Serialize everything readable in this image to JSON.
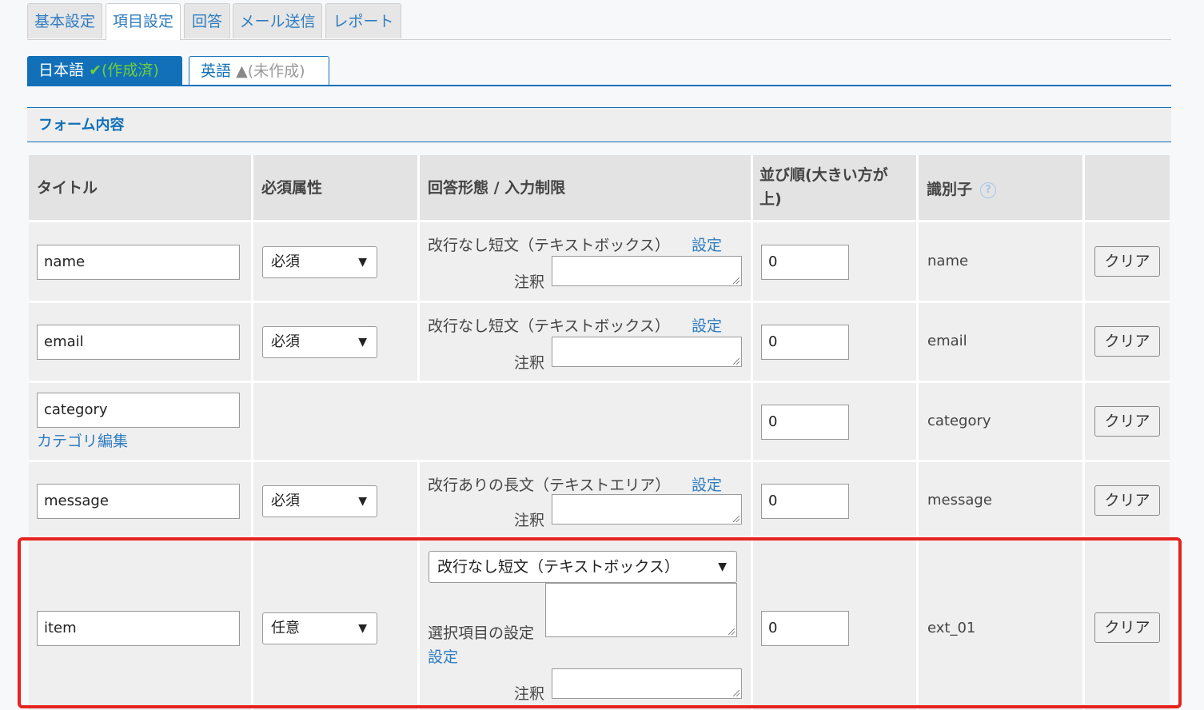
{
  "tabs": [
    {
      "label": "基本設定"
    },
    {
      "label": "項目設定"
    },
    {
      "label": "回答"
    },
    {
      "label": "メール送信"
    },
    {
      "label": "レポート"
    }
  ],
  "languages": {
    "ja": {
      "label": "日本語",
      "status": "(作成済)"
    },
    "en": {
      "label": "英語",
      "status": "(未作成)"
    }
  },
  "section_title": "フォーム内容",
  "columns": {
    "title": "タイトル",
    "required": "必須属性",
    "answer_type": "回答形態 / 入力制限",
    "order": "並び順(大きい方が上)",
    "identifier": "識別子",
    "help": "?"
  },
  "labels": {
    "setting_link": "設定",
    "note": "注釈",
    "clear": "クリア",
    "category_edit": "カテゴリ編集",
    "choice_setting": "選択項目の設定"
  },
  "rows": [
    {
      "title": "name",
      "required": "必須",
      "answer_type": "改行なし短文（テキストボックス）",
      "order": "0",
      "identifier": "name"
    },
    {
      "title": "email",
      "required": "必須",
      "answer_type": "改行なし短文（テキストボックス）",
      "order": "0",
      "identifier": "email"
    },
    {
      "title": "category",
      "order": "0",
      "identifier": "category"
    },
    {
      "title": "message",
      "required": "必須",
      "answer_type": "改行ありの長文（テキストエリア）",
      "order": "0",
      "identifier": "message"
    },
    {
      "title": "item",
      "required": "任意",
      "answer_type": "改行なし短文（テキストボックス）",
      "order": "0",
      "identifier": "ext_01"
    }
  ],
  "colors": {
    "accent": "#1170b8",
    "link": "#2f7cc1",
    "highlight": "#e5231f",
    "ok": "#6fcf3a"
  }
}
